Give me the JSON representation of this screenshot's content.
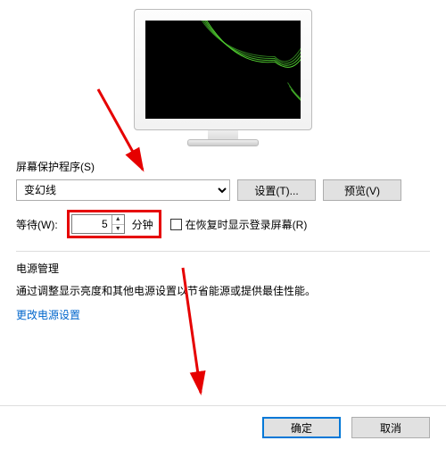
{
  "section": {
    "label": "屏幕保护程序(S)"
  },
  "screensaver": {
    "selected": "变幻线",
    "settings_btn": "设置(T)...",
    "preview_btn": "预览(V)"
  },
  "wait": {
    "label": "等待(W):",
    "value": "5",
    "unit": "分钟",
    "resume_label": "在恢复时显示登录屏幕(R)"
  },
  "power": {
    "title": "电源管理",
    "desc": "通过调整显示亮度和其他电源设置以节省能源或提供最佳性能。",
    "link": "更改电源设置"
  },
  "footer": {
    "ok": "确定",
    "cancel": "取消"
  }
}
